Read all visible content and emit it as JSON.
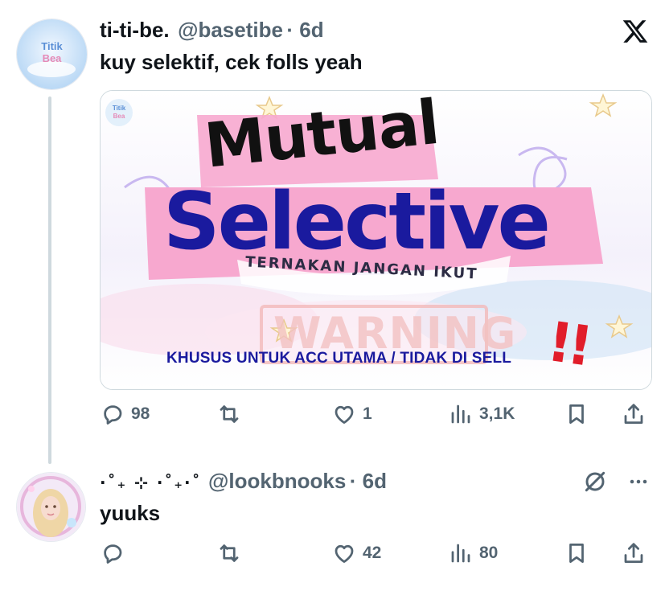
{
  "post": {
    "display_name": "ti-ti-be.",
    "handle": "@basetibe",
    "time": "· 6d",
    "text": "kuy selektif, cek folls yeah",
    "avatar_text": [
      "Titik",
      "Bea"
    ],
    "media": {
      "logo_text": [
        "Titik",
        "Bea"
      ],
      "title_line1": "Mutual",
      "title_line2": "Selective",
      "subtitle": "TERNAKAN JANGAN IKUT",
      "watermark": "WARNING",
      "footer": "KHUSUS UNTUK ACC UTAMA / TIDAK DI SELL",
      "exclaim": "!!"
    },
    "metrics": {
      "replies": "98",
      "likes": "1",
      "views": "3,1K"
    }
  },
  "reply": {
    "display_name": "·˚₊ ⊹ ·˚₊·˚",
    "handle": "@lookbnooks",
    "time": "· 6d",
    "text": "yuuks",
    "metrics": {
      "likes": "42",
      "views": "80"
    }
  },
  "colors": {
    "accent_blue": "#1a1a9e",
    "pink": "#f7a8cf",
    "warning_red": "#e11d2a",
    "muted": "#536471"
  },
  "icons": [
    "x-logo-icon",
    "reply-icon",
    "repost-icon",
    "like-icon",
    "views-icon",
    "bookmark-icon",
    "share-icon",
    "grok-slash-icon",
    "more-icon"
  ]
}
